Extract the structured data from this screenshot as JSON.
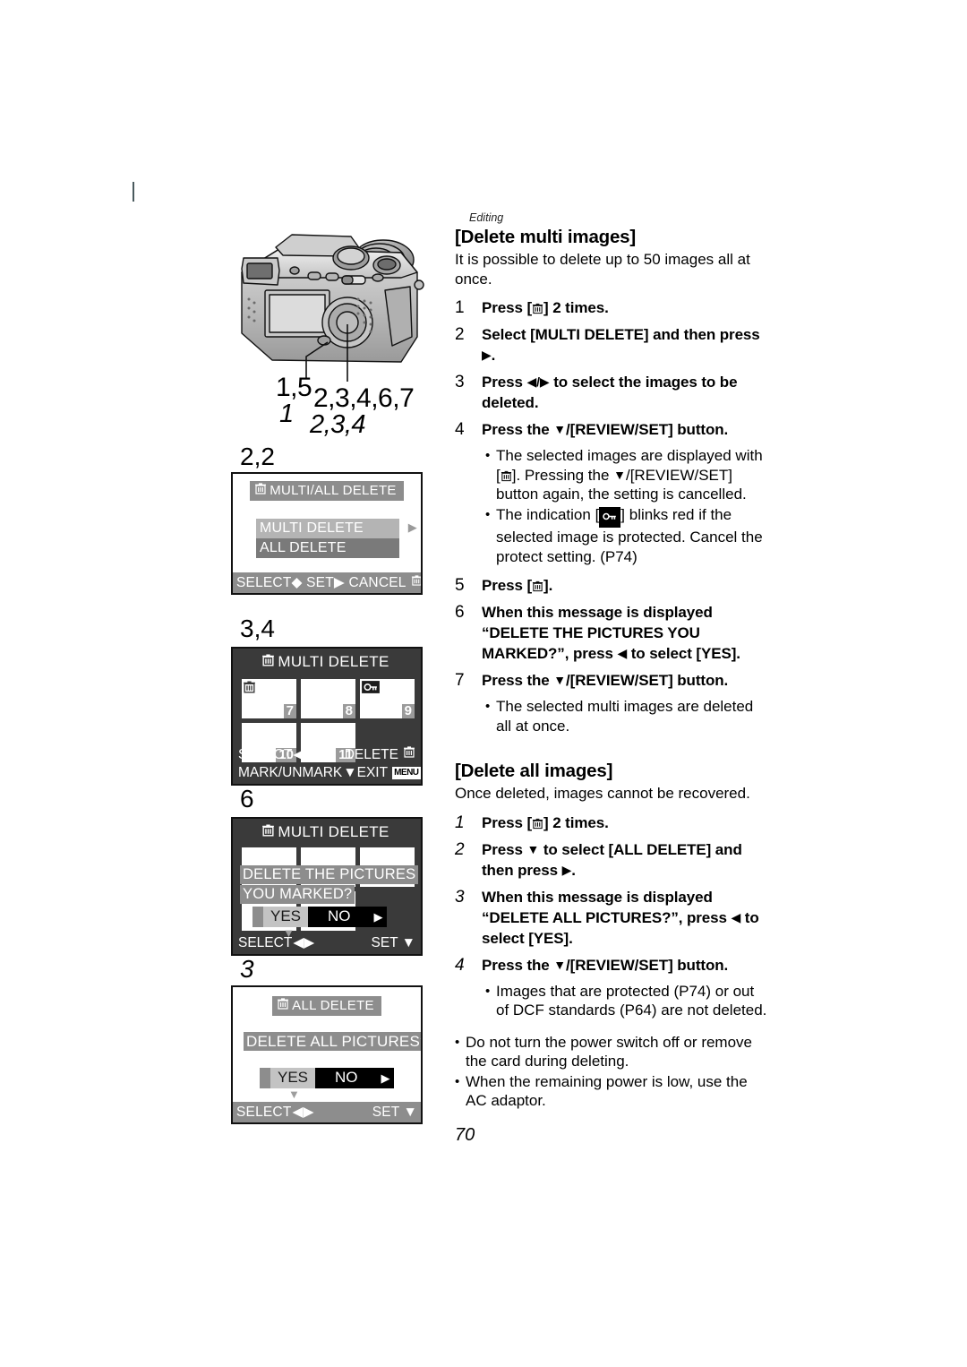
{
  "page_number": "70",
  "chapter_tag": "Editing",
  "callouts": {
    "button_upright": "1,5",
    "button_italic": "1",
    "cursor_upright": "2,3,4,6,7",
    "cursor_italic": "2,3,4"
  },
  "screens": [
    {
      "step_label": "2,2",
      "step_label_italic": false,
      "title": "MULTI/ALL DELETE",
      "title_icon": "trash-icon",
      "menu_items": [
        {
          "label": "MULTI DELETE",
          "selected": true,
          "arrow": "▶"
        },
        {
          "label": "ALL DELETE",
          "selected": false
        }
      ],
      "bottom_bar": "SELECT◆ SET▶ CANCEL",
      "bottom_bar_icon": "trash-icon"
    },
    {
      "step_label": "3,4",
      "step_label_italic": false,
      "title": "MULTI DELETE",
      "title_icon": "trash-icon",
      "thumbnails": [
        {
          "number": "7",
          "mark": "trash-icon"
        },
        {
          "number": "8",
          "mark": ""
        },
        {
          "number": "9",
          "mark": "protect-key-icon"
        },
        {
          "number": "10",
          "mark": ""
        },
        {
          "number": "11",
          "mark": ""
        }
      ],
      "bottom_left_1": "SELECT",
      "bottom_left_1_icon": "left-right-arrow-icon",
      "bottom_right_1": "DELETE",
      "bottom_right_1_icon": "trash-icon",
      "bottom_left_2": "MARK/UNMARK",
      "bottom_left_2_icon": "down-arrow-icon",
      "bottom_right_2": "EXIT",
      "bottom_right_2_icon": "menu-badge-icon"
    },
    {
      "step_label": "6",
      "step_label_italic": false,
      "title": "MULTI DELETE",
      "title_icon": "trash-icon",
      "message_line_1": "DELETE THE PICTURES",
      "message_line_2": "YOU MARKED?",
      "yes_label": "YES",
      "no_label": "NO",
      "selected_choice": "YES",
      "bottom_left": "SELECT",
      "bottom_left_icon": "left-right-arrow-icon",
      "bottom_right": "SET",
      "bottom_right_icon": "down-arrow-icon"
    },
    {
      "step_label": "3",
      "step_label_italic": true,
      "title": "ALL DELETE",
      "title_icon": "trash-icon",
      "message_line_1": "DELETE ALL PICTURES?",
      "yes_label": "YES",
      "no_label": "NO",
      "selected_choice": "YES",
      "bottom_left": "SELECT",
      "bottom_left_icon": "left-right-arrow-icon",
      "bottom_right": "SET",
      "bottom_right_icon": "down-arrow-icon"
    }
  ],
  "section_multi": {
    "heading": "[Delete multi images]",
    "intro": "It is possible to delete up to 50 images all at once.",
    "steps": [
      {
        "num": "1",
        "text_pre": "Press [",
        "icon": "trash-icon",
        "text_post": "] 2 times."
      },
      {
        "num": "2",
        "text_pre": "Select [MULTI DELETE] and then press ",
        "icon": "right-triangle-icon",
        "text_post": "."
      },
      {
        "num": "3",
        "text_pre": "Press ",
        "icon": "left-right-triangle-icon",
        "text_post": " to select the images to be deleted."
      },
      {
        "num": "4",
        "text_pre": "Press the ",
        "icon": "down-triangle-icon",
        "text_post": "/[REVIEW/SET] button."
      }
    ],
    "bullets_after_4": [
      {
        "pre": "The selected images are displayed with [",
        "icon": "trash-icon",
        "mid": "]. Pressing the ",
        "icon2": "down-triangle-icon",
        "post": "/[REVIEW/SET] button again, the setting is cancelled."
      },
      {
        "pre": "The indication [",
        "icon": "protect-key-icon",
        "post": "] blinks red if the selected image is protected. Cancel the protect setting. (P74)"
      }
    ],
    "steps_cont": [
      {
        "num": "5",
        "text_pre": "Press [",
        "icon": "trash-icon",
        "text_post": "]."
      },
      {
        "num": "6",
        "text_pre": "When this message is displayed “DELETE THE PICTURES YOU MARKED?”, press ",
        "icon": "left-triangle-icon",
        "text_post": " to select [YES]."
      },
      {
        "num": "7",
        "text_pre": "Press the ",
        "icon": "down-triangle-icon",
        "text_post": "/[REVIEW/SET] button."
      }
    ],
    "bullets_end": [
      {
        "text": "The selected multi images are deleted all at once."
      }
    ]
  },
  "section_all": {
    "heading": "[Delete all images]",
    "intro": "Once deleted, images cannot be recovered.",
    "steps": [
      {
        "num": "1",
        "text_pre": "Press [",
        "icon": "trash-icon",
        "text_post": "] 2 times."
      },
      {
        "num": "2",
        "text_pre": "Press ",
        "icon": "down-triangle-icon",
        "text_post2": " to select [ALL DELETE] and then press ",
        "icon2": "right-triangle-icon",
        "text_post": "."
      },
      {
        "num": "3",
        "text_pre": "When this message is displayed “DELETE ALL PICTURES?”, press ",
        "icon": "left-triangle-icon",
        "text_post": " to select [YES]."
      },
      {
        "num": "4",
        "text_pre": "Press the ",
        "icon": "down-triangle-icon",
        "text_post": "/[REVIEW/SET] button."
      }
    ],
    "bullets_after_4": [
      {
        "text": "Images that are protected (P74) or out of DCF standards (P64) are not deleted."
      }
    ],
    "notes": [
      {
        "text": "Do not turn the power switch off or remove the card during deleting."
      },
      {
        "text": "When the remaining power is low, use the AC adaptor."
      }
    ]
  }
}
